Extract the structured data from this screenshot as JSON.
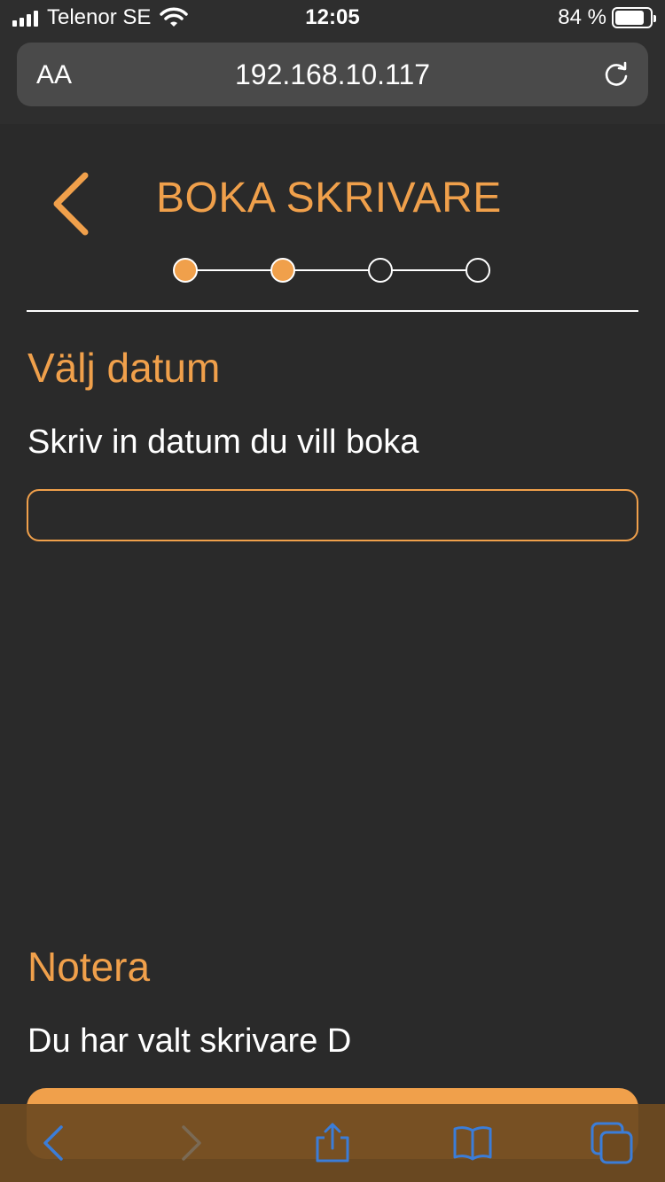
{
  "status_bar": {
    "carrier": "Telenor SE",
    "time": "12:05",
    "battery_text": "84 %",
    "battery_level": 0.84
  },
  "browser": {
    "aa_label": "AA",
    "url": "192.168.10.117"
  },
  "page": {
    "title": "BOKA SKRIVARE",
    "steps": {
      "total": 4,
      "completed": 2
    },
    "date_section": {
      "heading": "Välj datum",
      "instruction": "Skriv in datum du vill boka",
      "input_value": ""
    },
    "note_section": {
      "heading": "Notera",
      "text": "Du har valt skrivare D"
    }
  },
  "colors": {
    "accent": "#f0a04b",
    "background": "#2a2a2a",
    "toolbar_icon": "#3b7dd8",
    "toolbar_icon_disabled": "#7a6a55"
  },
  "toolbar": {
    "icons": [
      "back-icon",
      "forward-icon",
      "share-icon",
      "bookmarks-icon",
      "tabs-icon"
    ]
  }
}
